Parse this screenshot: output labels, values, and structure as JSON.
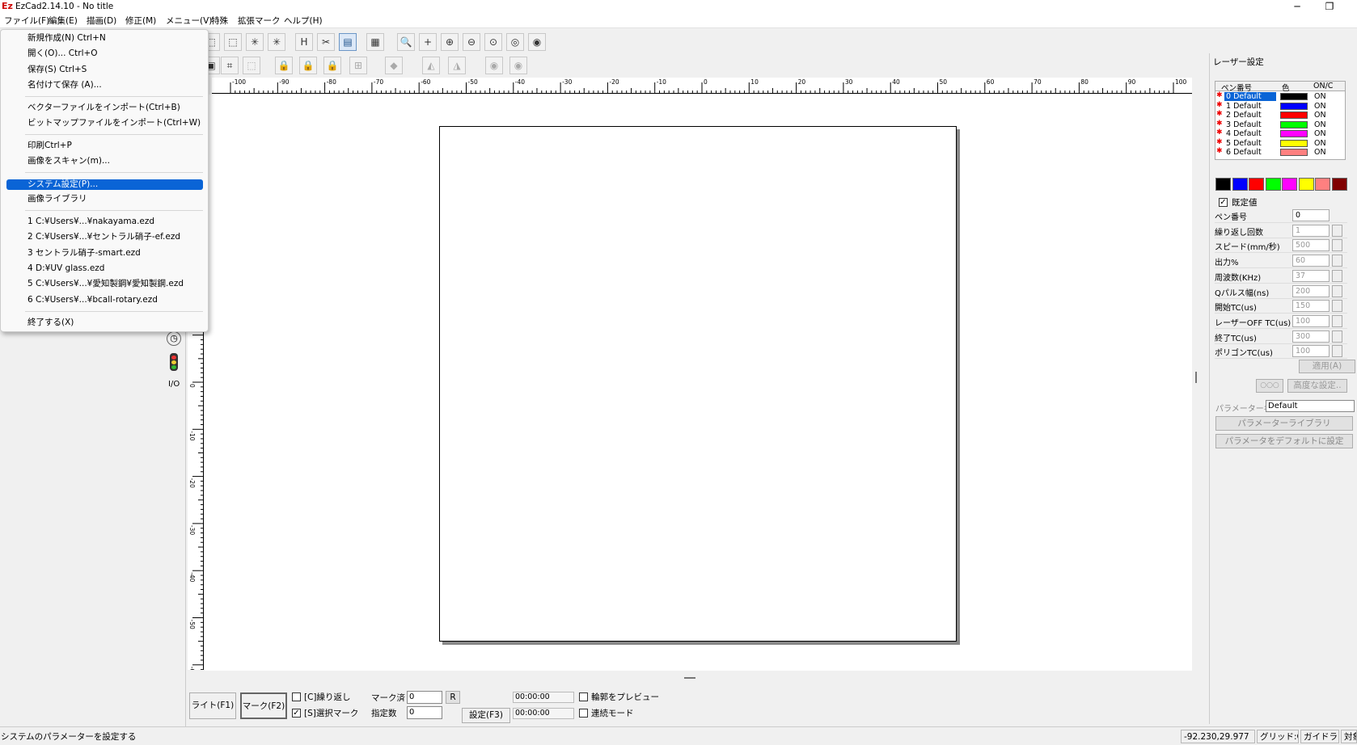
{
  "window": {
    "title": "EzCad2.14.10 - No title",
    "logo": "Ez",
    "minimize": "─",
    "restore": "❐"
  },
  "menu": [
    "ファイル(F)",
    "編集(E)",
    "描画(D)",
    "修正(M)",
    "メニュー(V)",
    "特殊",
    "拡張マーク",
    "ヘルプ(H)"
  ],
  "file_menu": {
    "items": [
      "新規作成(N) Ctrl+N",
      "開く(O)... Ctrl+O",
      "保存(S) Ctrl+S",
      "名付けて保存 (A)...",
      "ベクターファイルをインポート(Ctrl+B)",
      "ビットマップファイルをインポート(Ctrl+W)",
      "印刷Ctrl+P",
      "画像をスキャン(m)...",
      "システム設定(P)...",
      "画像ライブラリ",
      "1 C:¥Users¥...¥nakayama.ezd",
      "2 C:¥Users¥...¥セントラル硝子-ef.ezd",
      "3 セントラル硝子-smart.ezd",
      "4 D:¥UV glass.ezd",
      "5 C:¥Users¥...¥愛知製鋼¥愛知製鋼.ezd",
      "6 C:¥Users¥...¥bcall-rotary.ezd",
      "終了する(X)"
    ]
  },
  "ruler": {
    "h_labels": [
      "-100",
      "-90",
      "-80",
      "-70",
      "-60",
      "-50",
      "-40",
      "-30",
      "-20",
      "-10",
      "0",
      "10",
      "20",
      "30",
      "40",
      "50",
      "60",
      "70",
      "80",
      "90",
      "100"
    ],
    "v_labels": [
      "0",
      "-10",
      "-20",
      "-30",
      "-40",
      "-50",
      "-60"
    ]
  },
  "laser_panel": {
    "title": "レーザー設定",
    "headers": [
      "ペン番号",
      "色",
      "ON/C"
    ],
    "pens": [
      {
        "label": "0 Default",
        "color": "#000000",
        "state": "ON"
      },
      {
        "label": "1 Default",
        "color": "#0000ff",
        "state": "ON"
      },
      {
        "label": "2 Default",
        "color": "#ff0000",
        "state": "ON"
      },
      {
        "label": "3 Default",
        "color": "#00ff00",
        "state": "ON"
      },
      {
        "label": "4 Default",
        "color": "#ff00ff",
        "state": "ON"
      },
      {
        "label": "5 Default",
        "color": "#ffff00",
        "state": "ON"
      },
      {
        "label": "6 Default",
        "color": "#ff8080",
        "state": "ON"
      }
    ],
    "palette": [
      "#000000",
      "#0000ff",
      "#ff0000",
      "#00ff00",
      "#ff00ff",
      "#ffff00",
      "#ff8080",
      "#800000"
    ],
    "default_checkbox": "既定値",
    "params": [
      {
        "label": "ペン番号",
        "value": "0"
      },
      {
        "label": "繰り返し回数",
        "value": "1"
      },
      {
        "label": "スピード(mm/秒)",
        "value": "500"
      },
      {
        "label": "出力%",
        "value": "60"
      },
      {
        "label": "周波数(KHz)",
        "value": "37"
      },
      {
        "label": "Qパルス幅(ns)",
        "value": "200"
      },
      {
        "label": "開始TC(us)",
        "value": "150"
      },
      {
        "label": "レーザーOFF TC(us)",
        "value": "100"
      },
      {
        "label": "終了TC(us)",
        "value": "300"
      },
      {
        "label": "ポリゴンTC(us)",
        "value": "100"
      }
    ],
    "apply": "適用(A)",
    "circle_btn": "○○○",
    "advanced": "高度な設定..",
    "param_name_label": "パラメーター名",
    "param_name_value": "Default",
    "library": "パラメーターライブラリ",
    "set_default": "パラメータをデフォルトに設定"
  },
  "bottom": {
    "light": "ライト(F1)",
    "mark": "マーク(F2)",
    "repeat": "[C]繰り返し",
    "select_mark": "[S]選択マーク",
    "marked_label": "マーク済",
    "marked_value": "0",
    "r_btn": "R",
    "count_label": "指定数",
    "count_value": "0",
    "settings": "設定(F3)",
    "time1": "00:00:00",
    "time2": "00:00:00",
    "preview": "輪郭をプレビュー",
    "continuous": "連続モード"
  },
  "status": {
    "message": "システムのパラメーターを設定する",
    "coords": "-92.230,29.977",
    "grid": "グリッド:OFF",
    "guide": "ガイドライン",
    "object": "対象"
  }
}
